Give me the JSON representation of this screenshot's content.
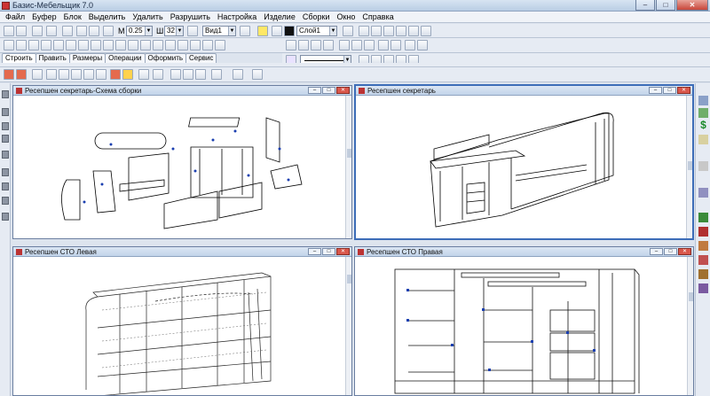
{
  "app": {
    "title": "Базис-Мебельщик 7.0"
  },
  "menu": [
    "Файл",
    "Буфер",
    "Блок",
    "Выделить",
    "Удалить",
    "Разрушить",
    "Настройка",
    "Изделие",
    "Сборки",
    "Окно",
    "Справка"
  ],
  "toolbar": {
    "m_label": "М",
    "m_value": "0.25",
    "w_label": "Ш",
    "w_value": "32",
    "view_value": "Вид1",
    "layer_value": "Слой1"
  },
  "tabs": [
    "Строить",
    "Править",
    "Размеры",
    "Операции",
    "Оформить",
    "Сервис"
  ],
  "windows": {
    "assembly": {
      "title": "Ресепшен секретарь-Схема сборки"
    },
    "secretary": {
      "title": "Ресепшен секретарь"
    },
    "left": {
      "title": "Ресепшен СТО Левая"
    },
    "right": {
      "title": "Ресепшен СТО Правая"
    }
  },
  "icons": {
    "rightbar_currency": "$"
  }
}
